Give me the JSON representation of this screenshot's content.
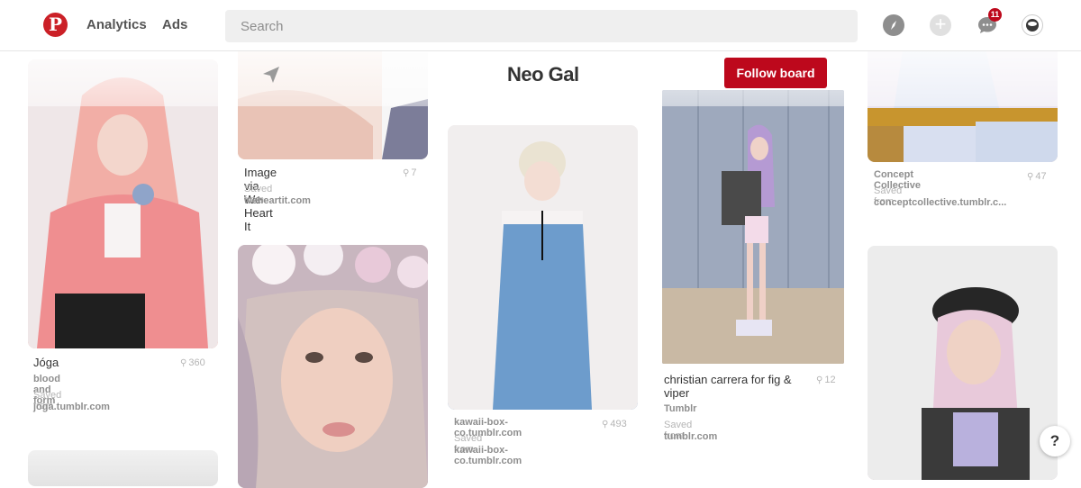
{
  "nav": {
    "analytics": "Analytics",
    "ads": "Ads",
    "search_placeholder": "Search",
    "notification_count": "11"
  },
  "board": {
    "title": "Neo Gal",
    "follow_label": "Follow board"
  },
  "pins": [
    {
      "title": "Jóga",
      "description": "blood and form",
      "saved_label": "Saved from",
      "source": "joga.tumblr.com",
      "count": "360"
    },
    {
      "title": "Image via We Heart It",
      "saved_label": "Saved from",
      "source": "weheartit.com",
      "count": "7"
    },
    {
      "title": "kawaii-box-co.tumblr.com",
      "saved_label": "Saved from",
      "source": "kawaii-box-co.tumblr.com",
      "count": "493"
    },
    {
      "title": "christian carrera for fig & viper",
      "description": "Tumblr",
      "saved_label": "Saved from",
      "source": "tumblr.com",
      "count": "12"
    },
    {
      "title": "Concept Collective",
      "saved_label": "Saved from",
      "source": "conceptcollective.tumblr.c...",
      "count": "47"
    }
  ],
  "help_label": "?",
  "colors": {
    "brand_red": "#bd081c",
    "logo_red": "#cb2027"
  }
}
